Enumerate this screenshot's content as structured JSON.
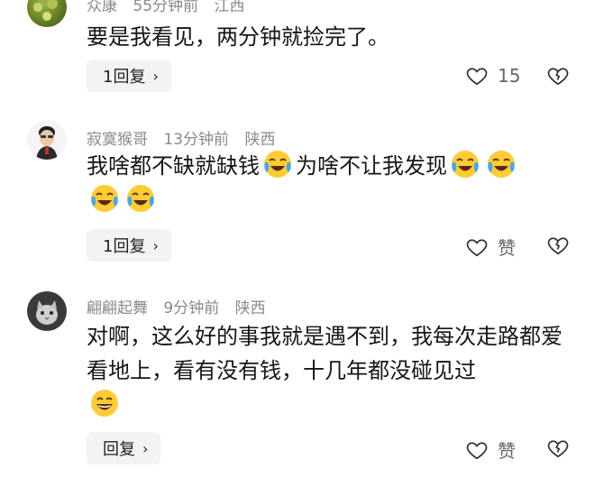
{
  "comments": [
    {
      "username": "众康",
      "time": "55分钟前",
      "location": "江西",
      "text": "要是我看见，两分钟就捡完了。",
      "reply_label": "1回复",
      "like_label": "15"
    },
    {
      "username": "寂寞猴哥",
      "time": "13分钟前",
      "location": "陕西",
      "text_part1": "我啥都不缺就缺钱",
      "text_part2": "为啥不让我发现",
      "reply_label": "1回复",
      "like_label": "赞"
    },
    {
      "username": "翩翩起舞",
      "time": "9分钟前",
      "location": "陕西",
      "text": "对啊，这么好的事我就是遇不到，我每次走路都爱看地上，看有没有钱，十几年都没碰见过",
      "reply_label": "回复",
      "like_label": "赞"
    }
  ],
  "icons": {
    "reply_chevron": "chevron-right-icon",
    "like": "heart-icon",
    "dislike": "broken-heart-icon",
    "emoji_cry_laugh": "tears-of-joy-emoji",
    "emoji_laugh": "grinning-emoji"
  },
  "chevron_char": "›"
}
